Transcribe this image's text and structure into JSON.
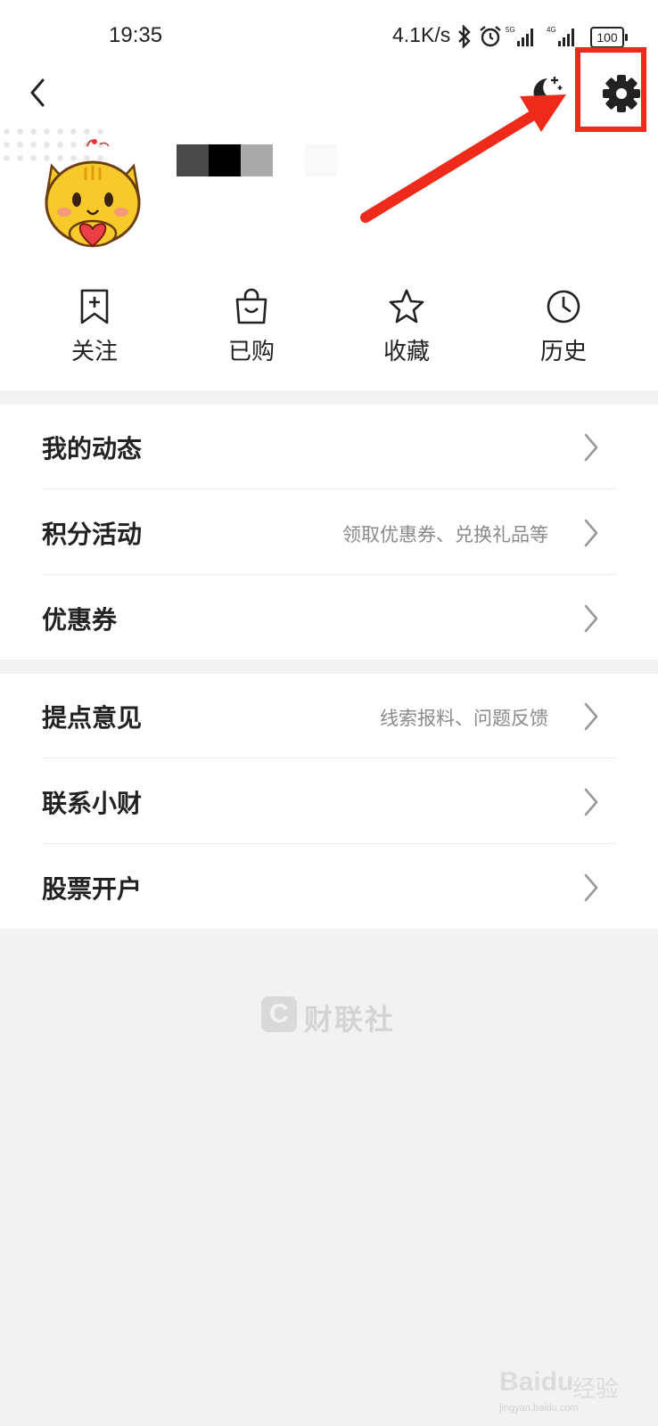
{
  "status_bar": {
    "time": "19:35",
    "net_speed": "4.1K/s",
    "signal_1": "5G",
    "signal_2": "4G",
    "battery": "100"
  },
  "header": {
    "back_icon": "chevron-left-icon",
    "night_mode_icon": "moon-stars-icon",
    "settings_icon": "gear-icon"
  },
  "annotation": {
    "box_color": "#ee2a1a",
    "arrow_color": "#ee2a1a"
  },
  "profile": {
    "avatar_icon": "cartoon-cat-avatar"
  },
  "quick_nav": [
    {
      "label": "关注",
      "icon": "bookmark-plus-icon"
    },
    {
      "label": "已购",
      "icon": "shopping-bag-icon"
    },
    {
      "label": "收藏",
      "icon": "star-icon"
    },
    {
      "label": "历史",
      "icon": "clock-icon"
    }
  ],
  "menu_group_1": [
    {
      "title": "我的动态",
      "subtitle": ""
    },
    {
      "title": "积分活动",
      "subtitle": "领取优惠券、兑换礼品等"
    },
    {
      "title": "优惠券",
      "subtitle": ""
    }
  ],
  "menu_group_2": [
    {
      "title": "提点意见",
      "subtitle": "线索报料、问题反馈"
    },
    {
      "title": "联系小财",
      "subtitle": ""
    },
    {
      "title": "股票开户",
      "subtitle": ""
    }
  ],
  "brand": {
    "logo_letter": "C",
    "name": "财联社"
  },
  "watermark": {
    "text": "Bai",
    "text2": "du",
    "cn": "经验",
    "url": "jingyan.baidu.com"
  }
}
